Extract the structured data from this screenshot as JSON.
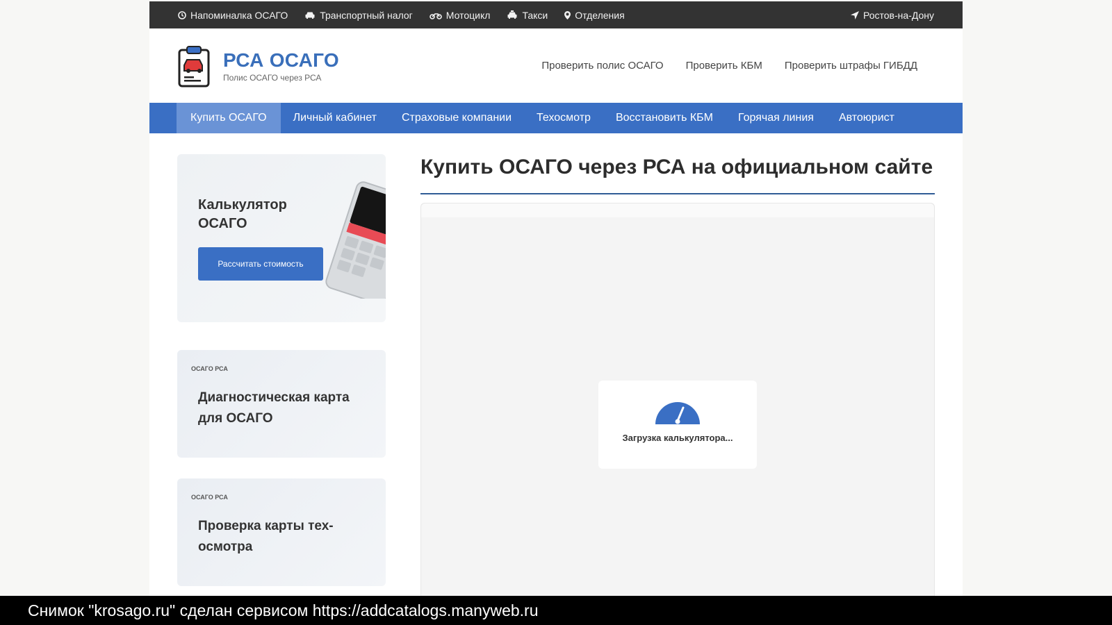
{
  "topbar": {
    "items": [
      {
        "label": "Напоминалка ОСАГО",
        "icon": "clock-icon"
      },
      {
        "label": "Транспортный налог",
        "icon": "car-icon"
      },
      {
        "label": "Мотоцикл",
        "icon": "motorcycle-icon"
      },
      {
        "label": "Такси",
        "icon": "taxi-icon"
      },
      {
        "label": "Отделения",
        "icon": "map-pin-icon"
      }
    ],
    "city": "Ростов-на-Дону",
    "city_icon": "location-arrow-icon"
  },
  "header": {
    "logo_title": "РСА ОСАГО",
    "logo_subtitle": "Полис ОСАГО через РСА",
    "links": [
      "Проверить полис ОСАГО",
      "Проверить КБМ",
      "Проверить штрафы ГИБДД"
    ]
  },
  "nav": {
    "items": [
      "Купить ОСАГО",
      "Личный кабинет",
      "Страховые компании",
      "Техосмотр",
      "Восстановить КБМ",
      "Горячая линия",
      "Автоюрист"
    ],
    "active": "Купить ОСАГО"
  },
  "sidebar": {
    "calc_card": {
      "title": "Калькулятор ОСАГО",
      "button": "Рассчитать стоимость"
    },
    "posts": [
      {
        "tag": "ОСАГО РСА",
        "title": "Диагностическая карта для ОСАГО"
      },
      {
        "tag": "ОСАГО РСА",
        "title": "Проверка карты тех-осмотра"
      }
    ]
  },
  "main": {
    "title": "Купить ОСАГО через РСА на официальном сайте",
    "loader_text": "Загрузка калькулятора..."
  },
  "caption": "Снимок \"krosago.ru\" сделан сервисом https://addcatalogs.manyweb.ru",
  "colors": {
    "brand": "#3a6fc4",
    "topbar": "#333333",
    "nav_active": "#6a93d6"
  }
}
